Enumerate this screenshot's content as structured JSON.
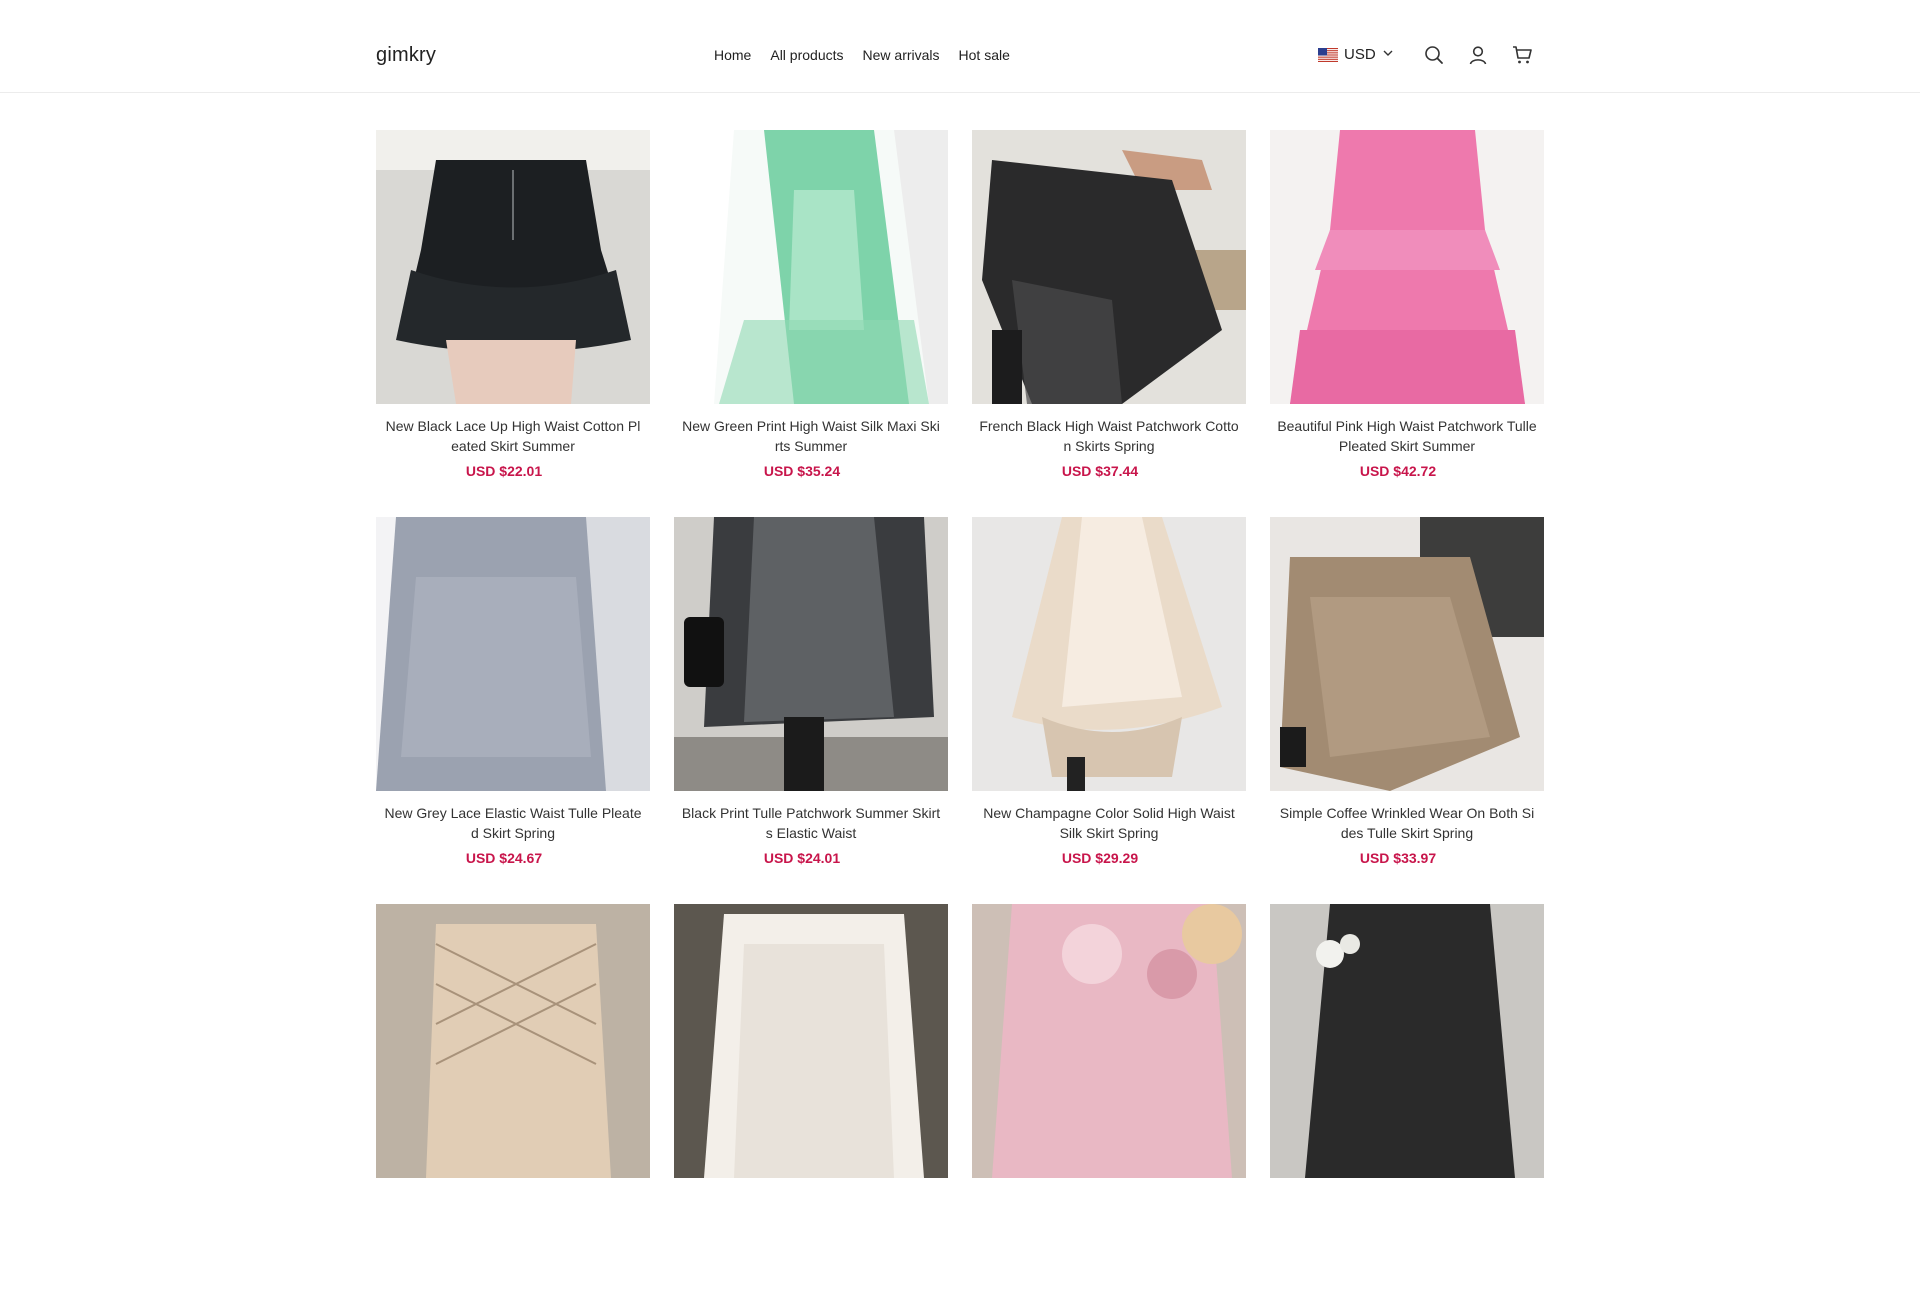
{
  "header": {
    "logo": "gimkry",
    "nav": [
      "Home",
      "All products",
      "New arrivals",
      "Hot sale"
    ],
    "currency": "USD",
    "icons": [
      "search-icon",
      "account-icon",
      "cart-icon"
    ]
  },
  "colors": {
    "price": "#c8154b",
    "border": "#ececec"
  },
  "products": [
    {
      "title": "New Black Lace Up High Waist Cotton Pleated Skirt Summer",
      "price": "USD $22.01"
    },
    {
      "title": "New Green Print High Waist Silk Maxi Skirts Summer",
      "price": "USD $35.24"
    },
    {
      "title": "French Black High Waist Patchwork Cotton Skirts Spring",
      "price": "USD $37.44"
    },
    {
      "title": "Beautiful Pink High Waist Patchwork Tulle Pleated Skirt Summer",
      "price": "USD $42.72"
    },
    {
      "title": "New Grey Lace Elastic Waist Tulle Pleated Skirt Spring",
      "price": "USD $24.67"
    },
    {
      "title": "Black Print Tulle Patchwork Summer Skirts Elastic Waist",
      "price": "USD $24.01"
    },
    {
      "title": "New Champagne Color Solid High Waist Silk Skirt Spring",
      "price": "USD $29.29"
    },
    {
      "title": "Simple Coffee Wrinkled Wear On Both Sides Tulle Skirt Spring",
      "price": "USD $33.97"
    },
    {
      "title": "",
      "price": ""
    },
    {
      "title": "",
      "price": ""
    },
    {
      "title": "",
      "price": ""
    },
    {
      "title": "",
      "price": ""
    }
  ]
}
